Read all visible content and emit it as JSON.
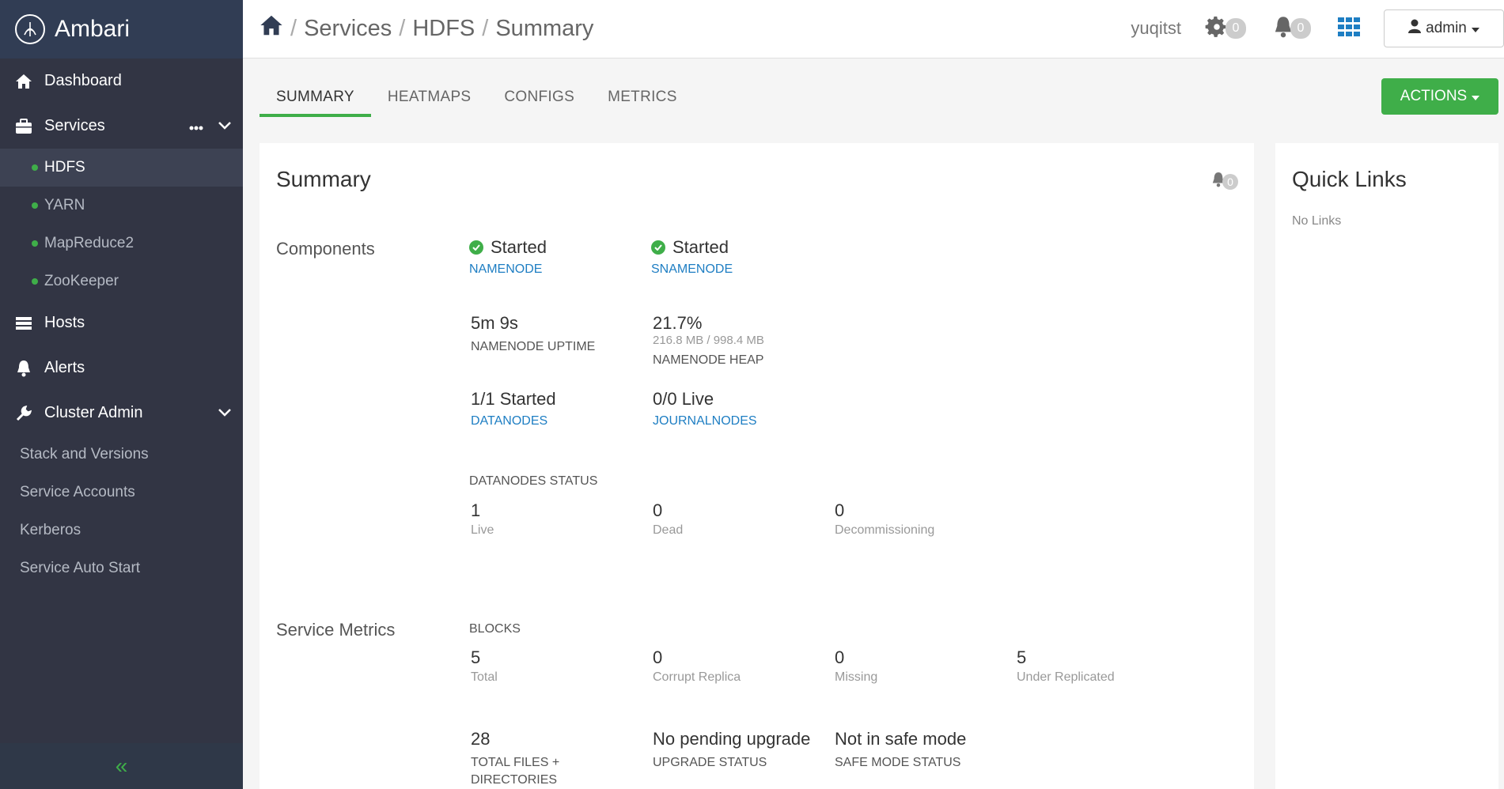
{
  "brand": {
    "name": "Ambari"
  },
  "sidebar": {
    "dashboard": "Dashboard",
    "services": "Services",
    "service_items": [
      {
        "label": "HDFS"
      },
      {
        "label": "YARN"
      },
      {
        "label": "MapReduce2"
      },
      {
        "label": "ZooKeeper"
      }
    ],
    "hosts": "Hosts",
    "alerts": "Alerts",
    "cluster_admin": "Cluster Admin",
    "admin_items": [
      {
        "label": "Stack and Versions"
      },
      {
        "label": "Service Accounts"
      },
      {
        "label": "Kerberos"
      },
      {
        "label": "Service Auto Start"
      }
    ]
  },
  "breadcrumb": {
    "services": "Services",
    "service": "HDFS",
    "page": "Summary",
    "separator": "/"
  },
  "topbar": {
    "cluster": "yuqitst",
    "ops_count": "0",
    "alerts_count": "0",
    "user": "admin"
  },
  "tabs": [
    {
      "label": "SUMMARY"
    },
    {
      "label": "HEATMAPS"
    },
    {
      "label": "CONFIGS"
    },
    {
      "label": "METRICS"
    }
  ],
  "actions_label": "ACTIONS",
  "summary": {
    "title": "Summary",
    "alert_count": "0",
    "components_label": "Components",
    "namenode": {
      "status": "Started",
      "name": "NAMENODE"
    },
    "snamenode": {
      "status": "Started",
      "name": "SNAMENODE"
    },
    "uptime": {
      "value": "5m 9s",
      "label": "NAMENODE UPTIME"
    },
    "heap": {
      "value": "21.7%",
      "detail": "216.8 MB / 998.4 MB",
      "label": "NAMENODE HEAP"
    },
    "datanodes": {
      "value": "1/1 Started",
      "label": "DATANODES"
    },
    "journalnodes": {
      "value": "0/0 Live",
      "label": "JOURNALNODES"
    },
    "dn_status": {
      "heading": "DATANODES STATUS",
      "live": {
        "value": "1",
        "label": "Live"
      },
      "dead": {
        "value": "0",
        "label": "Dead"
      },
      "decom": {
        "value": "0",
        "label": "Decommissioning"
      }
    },
    "metrics_label": "Service Metrics",
    "blocks": {
      "heading": "BLOCKS",
      "total": {
        "value": "5",
        "label": "Total"
      },
      "corrupt": {
        "value": "0",
        "label": "Corrupt Replica"
      },
      "missing": {
        "value": "0",
        "label": "Missing"
      },
      "under": {
        "value": "5",
        "label": "Under Replicated"
      }
    },
    "files": {
      "value": "28",
      "label": "TOTAL FILES + DIRECTORIES"
    },
    "upgrade": {
      "value": "No pending upgrade",
      "label": "UPGRADE STATUS"
    },
    "safemode": {
      "value": "Not in safe mode",
      "label": "SAFE MODE STATUS"
    }
  },
  "quick_links": {
    "title": "Quick Links",
    "empty": "No Links"
  },
  "colors": {
    "sidebar": "#323544",
    "accent": "#3fae49",
    "link": "#1e7ec3"
  }
}
